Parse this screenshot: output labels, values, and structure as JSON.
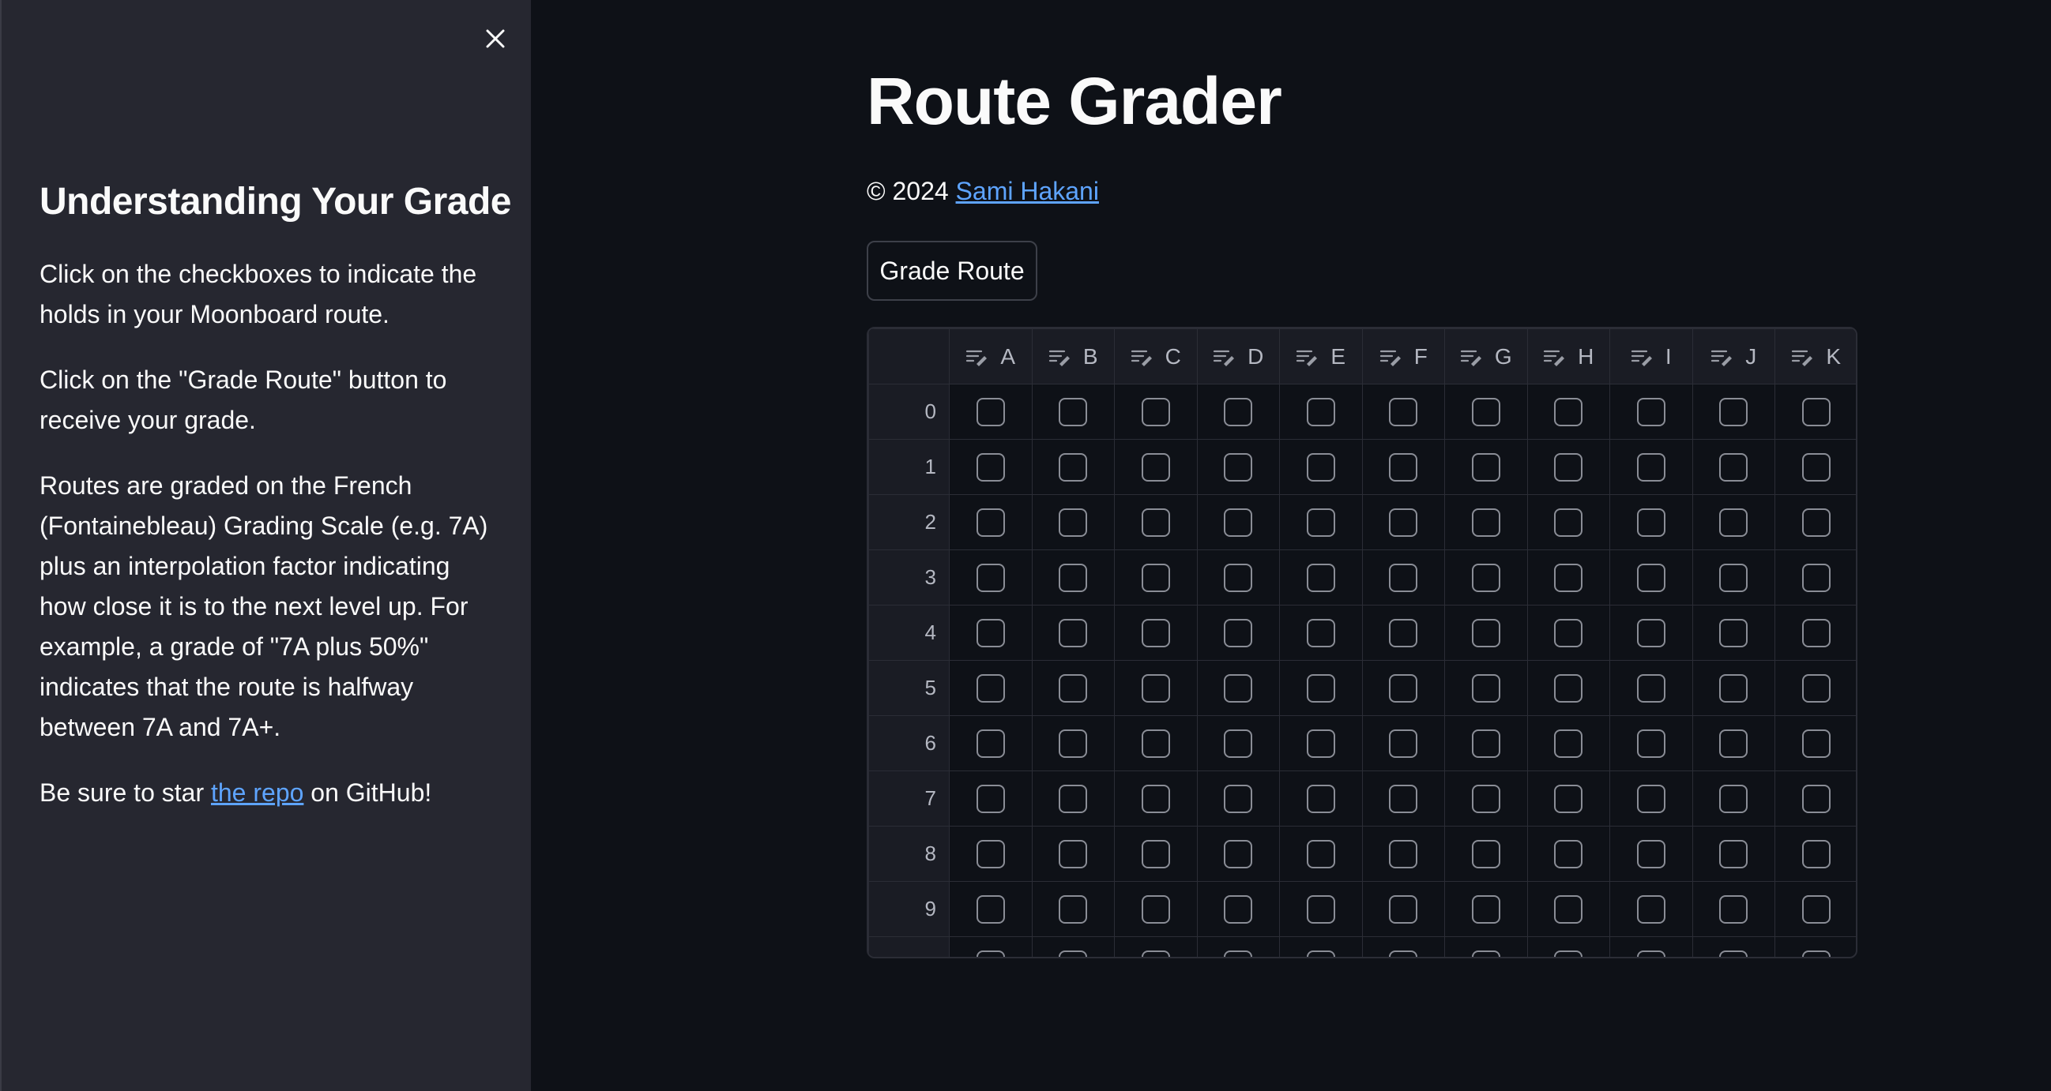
{
  "sidebar": {
    "heading": "Understanding Your Grade",
    "p1": "Click on the checkboxes to indicate the holds in your Moonboard route.",
    "p2": "Click on the \"Grade Route\" button to receive your grade.",
    "p3": "Routes are graded on the French (Fontainebleau) Grading Scale (e.g. 7A) plus an interpolation factor indicating how close it is to the next level up. For example, a grade of \"7A plus 50%\" indicates that the route is halfway between 7A and 7A+.",
    "p4_before": "Be sure to star ",
    "p4_link": "the repo",
    "p4_after": " on GitHub!",
    "close_icon": "close-icon"
  },
  "main": {
    "title": "Route Grader",
    "copyright_prefix": "© 2024 ",
    "author_link": "Sami Hakani",
    "grade_button": "Grade Route"
  },
  "grid": {
    "columns": [
      "A",
      "B",
      "C",
      "D",
      "E",
      "F",
      "G",
      "H",
      "I",
      "J",
      "K"
    ],
    "rows": [
      "0",
      "1",
      "2",
      "3",
      "4",
      "5",
      "6",
      "7",
      "8",
      "9"
    ],
    "header_icon": "edit-column-icon"
  },
  "colors": {
    "background": "#0e1117",
    "sidebar": "#262730",
    "link": "#5ea4ff",
    "grid_border": "#2b2d36"
  }
}
